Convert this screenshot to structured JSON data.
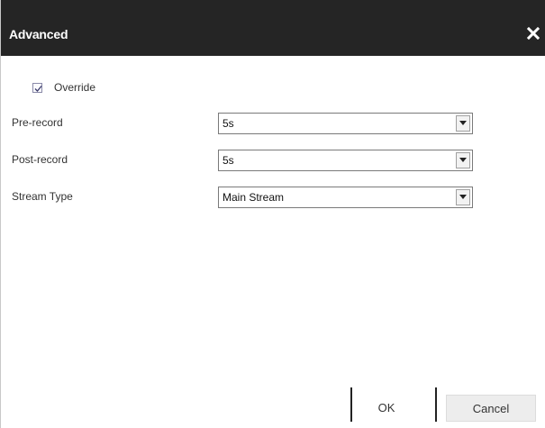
{
  "dialog": {
    "title": "Advanced",
    "close_glyph": "✕",
    "close_icon": "close-icon"
  },
  "override": {
    "label": "Override",
    "checked": true,
    "check_icon": "checkmark-icon"
  },
  "fields": [
    {
      "label": "Pre-record",
      "value": "5s"
    },
    {
      "label": "Post-record",
      "value": "5s"
    },
    {
      "label": "Stream Type",
      "value": "Main Stream"
    }
  ],
  "select_arrow_icon": "chevron-down-icon",
  "buttons": {
    "ok_label": "OK",
    "cancel_label": "Cancel"
  },
  "colors": {
    "titlebar": "#252525",
    "cancel_bg": "#ededed"
  }
}
